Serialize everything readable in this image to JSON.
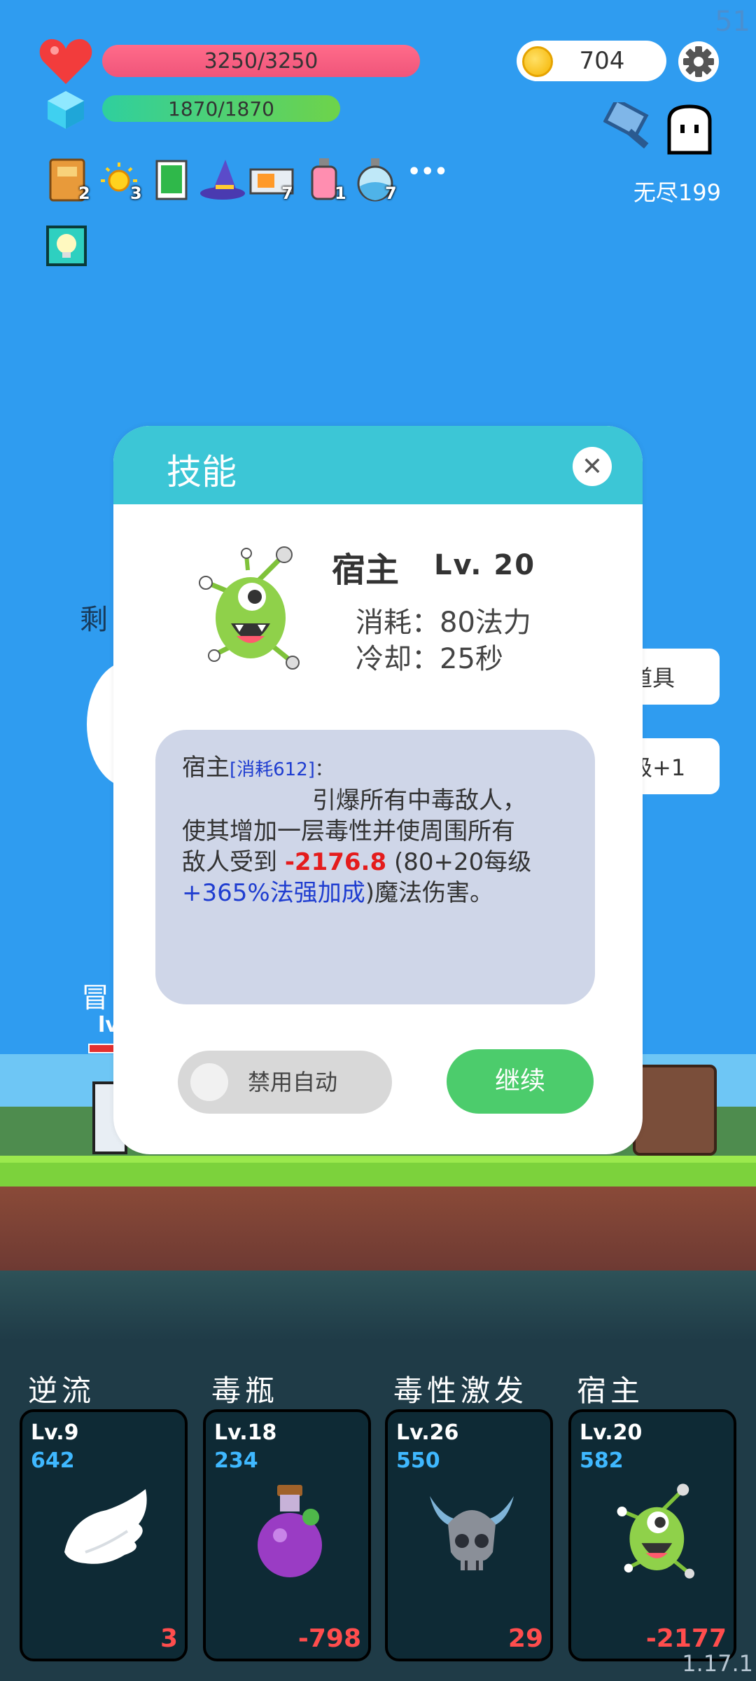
{
  "system": {
    "fps": "51",
    "version": "1.17.1"
  },
  "hud": {
    "hp_text": "3250/3250",
    "mp_text": "1870/1870",
    "coins": "704",
    "mode_text": "无尽199",
    "inventory": [
      {
        "icon": "book-icon",
        "count": "2"
      },
      {
        "icon": "sun-icon",
        "count": "3"
      },
      {
        "icon": "card-icon",
        "count": ""
      },
      {
        "icon": "wizard-hat-icon",
        "count": ""
      },
      {
        "icon": "briefcase-icon",
        "count": "7"
      },
      {
        "icon": "potion-bottle-icon",
        "count": "1"
      },
      {
        "icon": "flask-icon",
        "count": "7"
      }
    ],
    "more_label": "•••"
  },
  "background": {
    "left_text": "剩",
    "side_button_1": "道具",
    "side_button_2": "级+1",
    "player_name_partial": "冒",
    "player_level_partial": "lv"
  },
  "modal": {
    "title": "技能",
    "close_symbol": "✕",
    "skill_name": "宿主",
    "skill_level": "Lv. 20",
    "cost_line": "消耗：80法力",
    "cooldown_line": "冷却：25秒",
    "desc_name": "宿主",
    "desc_tag": "[消耗612]",
    "desc_colon": "：",
    "desc_line1": "引爆所有中毒敌人，",
    "desc_line2": "使其增加一层毒性并使周围所有",
    "desc_line3_a": "敌人受到 ",
    "desc_damage": "-2176.8",
    "desc_line3_b": " (80+20每级",
    "desc_scaling": "+365%法强加成",
    "desc_line4_b": ")魔法伤害。",
    "toggle_label": "禁用自动",
    "toggle_on": false,
    "continue_label": "继续"
  },
  "skills": [
    {
      "name": "逆流",
      "level": "Lv.9",
      "cost": "642",
      "value": "3",
      "icon": "wing-icon"
    },
    {
      "name": "毒瓶",
      "level": "Lv.18",
      "cost": "234",
      "value": "-798",
      "icon": "poison-flask-icon"
    },
    {
      "name": "毒性激发",
      "level": "Lv.26",
      "cost": "550",
      "value": "29",
      "icon": "horned-skull-icon"
    },
    {
      "name": "宿主",
      "level": "Lv.20",
      "cost": "582",
      "value": "-2177",
      "icon": "eyeball-monster-icon"
    }
  ],
  "colors": {
    "sky": "#2f9cf0",
    "modal_header": "#3cc6d6",
    "continue_button": "#4ccc6c",
    "hp": "#f0557a",
    "damage_red": "#e41c1c",
    "scaling_blue": "#1f3dd0"
  }
}
